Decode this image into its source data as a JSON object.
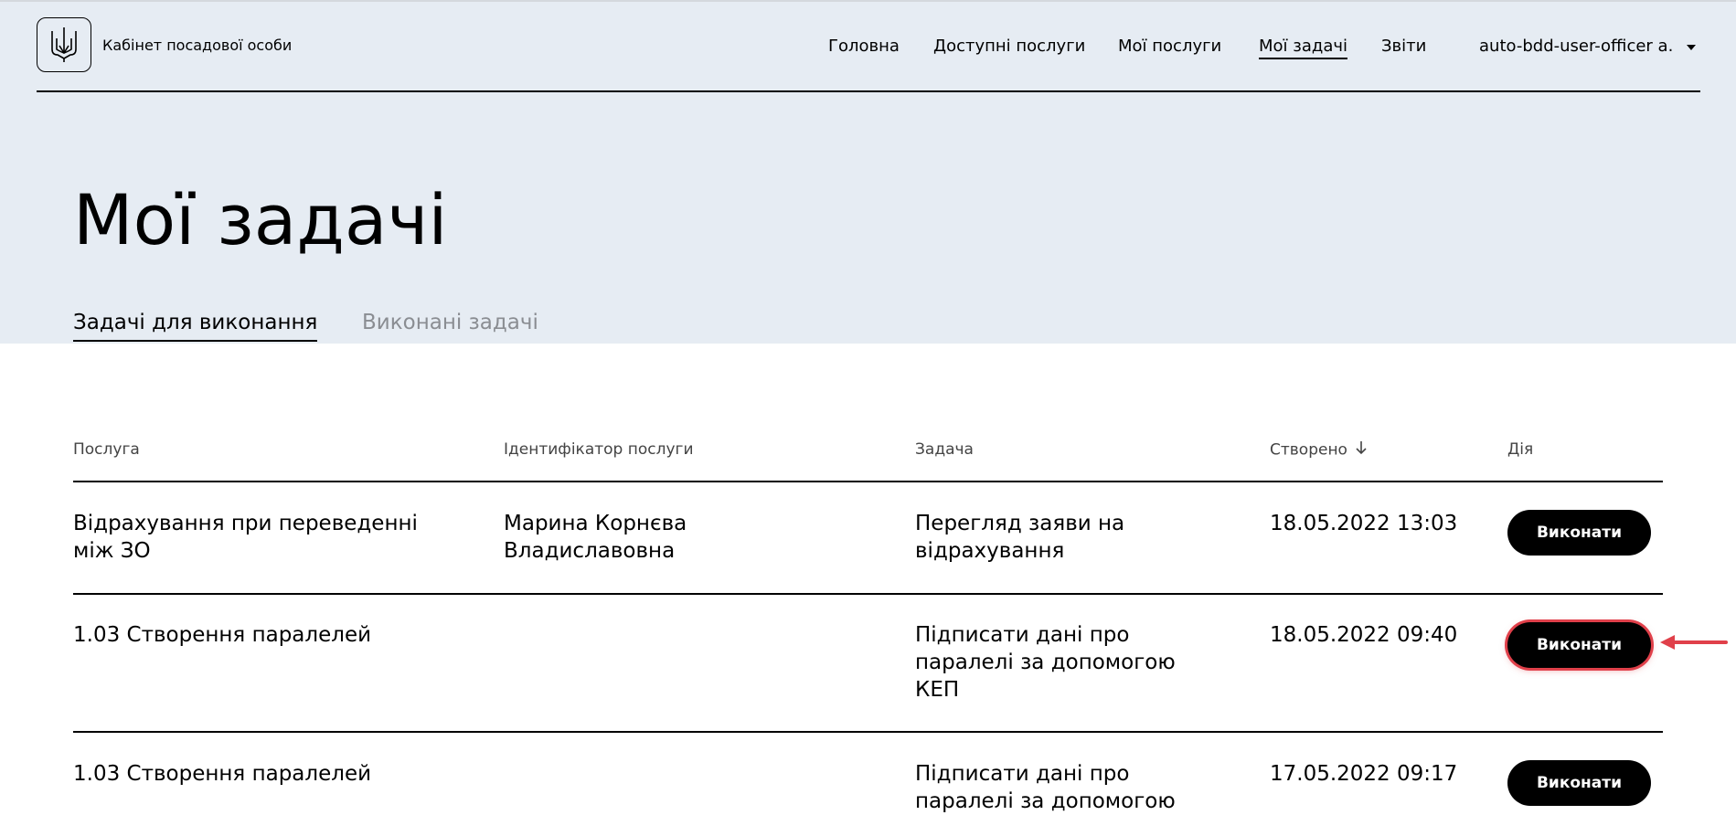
{
  "header": {
    "logo_text": "Кабінет посадової особи",
    "nav": [
      {
        "label": "Головна"
      },
      {
        "label": "Доступні послуги"
      },
      {
        "label": "Мої послуги"
      },
      {
        "label": "Мої задачі"
      },
      {
        "label": "Звіти"
      }
    ],
    "active_nav": "Мої задачі",
    "user_name": "auto-bdd-user-officer a."
  },
  "page": {
    "title": "Мої задачі"
  },
  "tabs": [
    {
      "label": "Задачі для виконання"
    },
    {
      "label": "Виконані задачі"
    }
  ],
  "table": {
    "columns": [
      "Послуга",
      "Ідентифікатор послуги",
      "Задача",
      "Створено",
      "Дія"
    ],
    "rows": [
      {
        "service_line1": "Відрахування при переведенні",
        "service_line2": "між ЗО",
        "identifier_line1": "Марина Корнєва",
        "identifier_line2": "Владиславовна",
        "task_line1": "Перегляд заяви на",
        "task_line2": "відрахування",
        "task_line3": "",
        "created": "18.05.2022 13:03",
        "action": "Виконати"
      },
      {
        "service_line1": "1.03 Створення паралелей",
        "service_line2": "",
        "identifier_line1": "",
        "identifier_line2": "",
        "task_line1": "Підписати дані про",
        "task_line2": "паралелі за допомогою",
        "task_line3": "КЕП",
        "created": "18.05.2022 09:40",
        "action": "Виконати"
      },
      {
        "service_line1": "1.03 Створення паралелей",
        "service_line2": "",
        "identifier_line1": "",
        "identifier_line2": "",
        "task_line1": "Підписати дані про",
        "task_line2": "паралелі за допомогою",
        "task_line3": "",
        "created": "17.05.2022 09:17",
        "action": "Виконати"
      }
    ]
  },
  "icons": {
    "logo": "trident-icon",
    "user_menu": "caret-down-icon",
    "sort": "arrow-down-icon",
    "annotation": "red-arrow-icon"
  },
  "colors": {
    "hero_bg": "#e6ecf3",
    "button_bg": "#000000",
    "highlight": "#e0404a",
    "inactive_tab": "#8a8d92"
  }
}
